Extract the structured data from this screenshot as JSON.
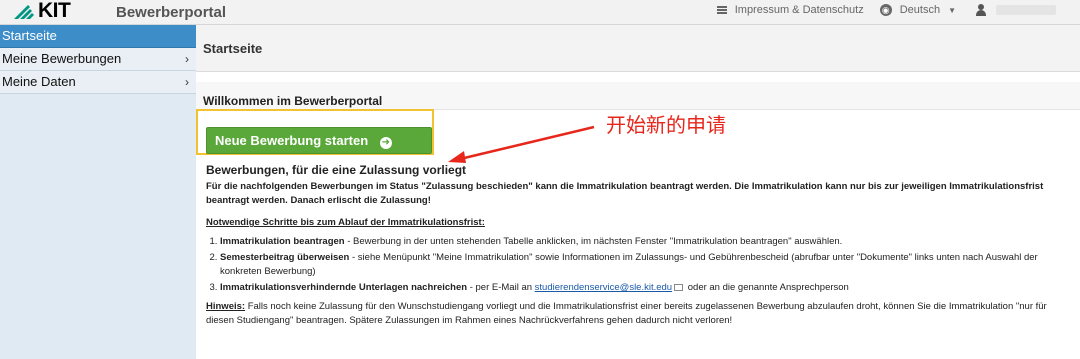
{
  "header": {
    "logo_text": "KIT",
    "app_title": "Bewerberportal",
    "impressum": "Impressum & Datenschutz",
    "language": "Deutsch"
  },
  "sidebar": {
    "items": [
      {
        "label": "Startseite",
        "active": true
      },
      {
        "label": "Meine Bewerbungen",
        "active": false
      },
      {
        "label": "Meine Daten",
        "active": false
      }
    ]
  },
  "main": {
    "page_title": "Startseite",
    "welcome": "Willkommen im Bewerberportal",
    "cta_label": "Neue Bewerbung starten",
    "annotation": "开始新的申请",
    "section_title": "Bewerbungen, für die eine Zulassung vorliegt",
    "intro": "Für die nachfolgenden Bewerbungen im Status \"Zulassung beschieden\" kann die Immatrikulation beantragt werden. Die Immatrikulation kann nur bis zur jeweiligen Immatrikulationsfrist beantragt werden. Danach erlischt die Zulassung!",
    "steps_title": "Notwendige Schritte bis zum Ablauf der Immatrikulationsfrist:",
    "steps": [
      {
        "bold": "Immatrikulation beantragen",
        "text": " - Bewerbung in der unten stehenden Tabelle anklicken, im nächsten Fenster \"Immatrikulation beantragen\" auswählen."
      },
      {
        "bold": "Semesterbeitrag überweisen",
        "text": " - siehe Menüpunkt \"Meine Immatrikulation\" sowie Informationen im Zulassungs- und Gebührenbescheid (abrufbar unter \"Dokumente\" links unten nach Auswahl der konkreten Bewerbung)"
      },
      {
        "bold": "Immatrikulationsverhindernde Unterlagen nachreichen",
        "text": " - per E-Mail an ",
        "link": "studierendenservice@sle.kit.edu",
        "text2": " oder an die genannte Ansprechperson"
      }
    ],
    "hint_label": "Hinweis:",
    "hint_text": " Falls noch keine Zulassung für den Wunschstudiengang vorliegt und die Immatrikulationsfrist einer bereits zugelassenen Bewerbung abzulaufen droht, können Sie die Immatrikulation \"nur für diesen Studiengang\" beantragen. Spätere Zulassungen im Rahmen eines Nachrückverfahrens gehen dadurch nicht verloren!"
  },
  "colors": {
    "accent_blue": "#3d8dc9",
    "button_green": "#5aa83a",
    "highlight_yellow": "#f2c230",
    "annotation_red": "#e8271c"
  }
}
